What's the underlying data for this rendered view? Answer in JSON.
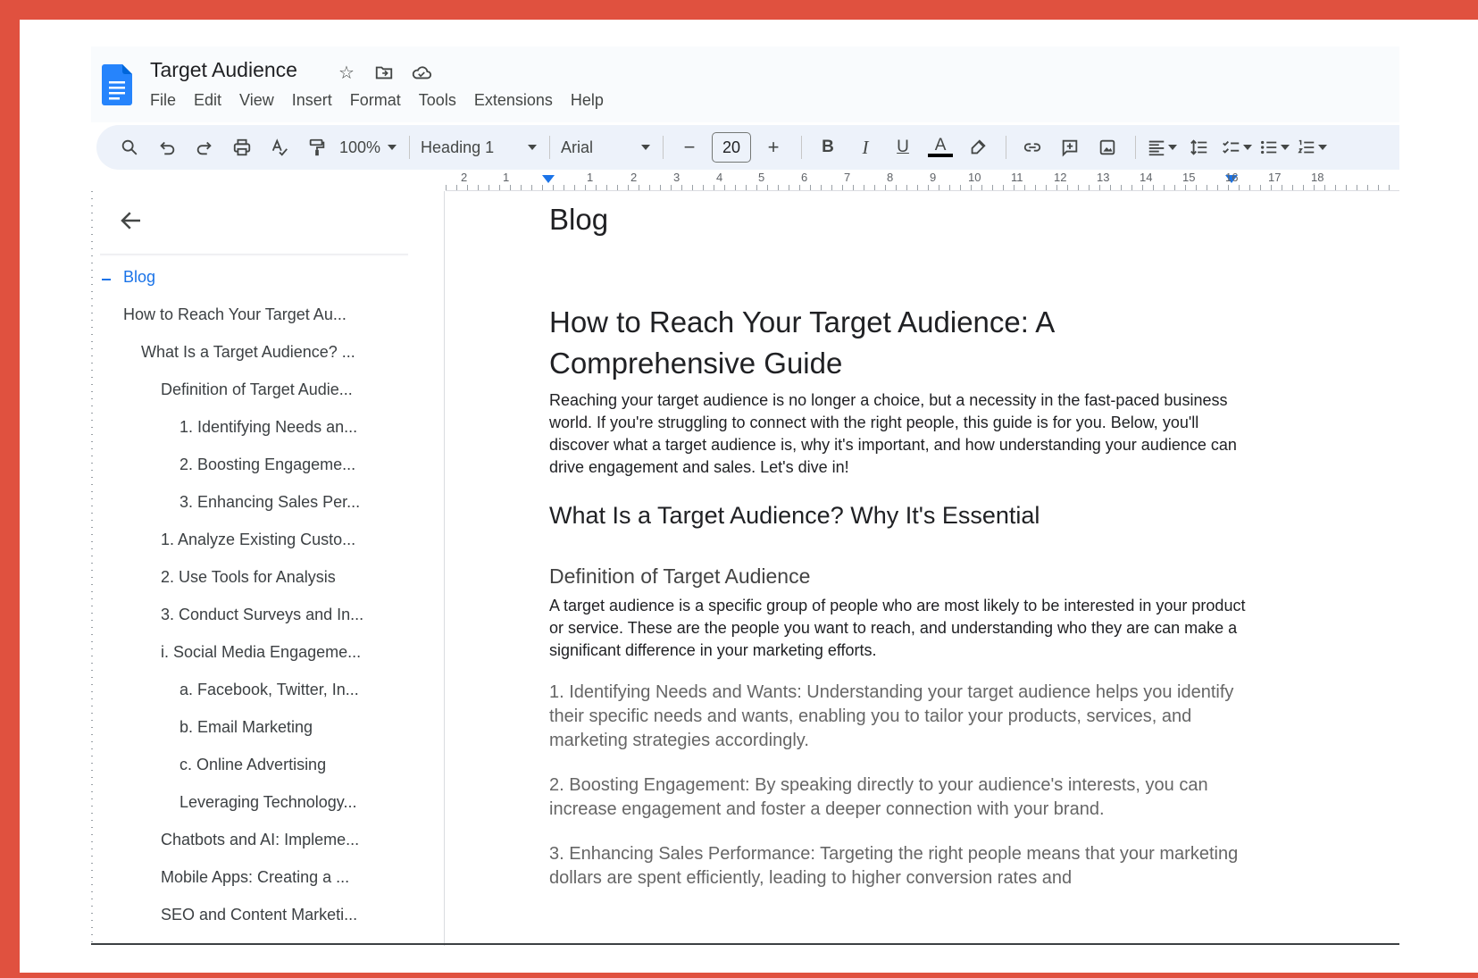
{
  "document": {
    "title": "Target Audience"
  },
  "menu": [
    "File",
    "Edit",
    "View",
    "Insert",
    "Format",
    "Tools",
    "Extensions",
    "Help"
  ],
  "toolbar": {
    "zoom": "100%",
    "style": "Heading 1",
    "font": "Arial",
    "font_size": "20",
    "minus": "−",
    "plus": "+",
    "bold": "B",
    "italic": "I",
    "underline": "U",
    "text_color": "A"
  },
  "ruler": {
    "numbers": [
      "2",
      "1",
      "1",
      "2",
      "3",
      "4",
      "5",
      "6",
      "7",
      "8",
      "9",
      "10",
      "11",
      "12",
      "13",
      "14",
      "15",
      "16",
      "17",
      "18"
    ]
  },
  "outline": {
    "items": [
      "Blog",
      "How to Reach Your Target Au...",
      "What Is a Target Audience? ...",
      "Definition of Target Audie...",
      "1. Identifying Needs an...",
      "2. Boosting Engageme...",
      "3. Enhancing Sales Per...",
      "1. Analyze Existing Custo...",
      "2. Use Tools for Analysis",
      "3. Conduct Surveys and In...",
      "i. Social Media Engageme...",
      "a. Facebook, Twitter, In...",
      "b. Email Marketing",
      "c. Online Advertising",
      "Leveraging Technology...",
      "Chatbots and AI: Impleme...",
      "Mobile Apps: Creating a ...",
      "SEO and Content Marketi..."
    ]
  },
  "body": {
    "title": "Blog",
    "h1": "How to Reach Your Target Audience: A Comprehensive Guide",
    "p1": "Reaching your target audience is no longer a choice, but a necessity in the fast-paced business world. If you're struggling to connect with the right people, this guide is for you. Below, you'll discover what a target audience is, why it's important, and how understanding your audience can drive engagement and sales. Let's dive in!",
    "h2": "What Is a Target Audience? Why It's Essential",
    "h3": "Definition of Target Audience",
    "p2": "A target audience is a specific group of people who are most likely to be interested in your product or service. These are the people you want to reach, and understanding who they are can make a significant difference in your marketing efforts.",
    "point1": "1. Identifying Needs and Wants: Understanding your target audience helps you identify their specific needs and wants, enabling you to tailor your products, services, and marketing strategies accordingly.",
    "point2": "2. Boosting Engagement: By speaking directly to your audience's interests, you can increase engagement and foster a deeper connection with your brand.",
    "point3": "3. Enhancing Sales Performance: Targeting the right people means that your marketing dollars are spent efficiently, leading to higher conversion rates and"
  },
  "colors": {
    "frame": "#e0513f",
    "accent": "#1a73e8",
    "toolbar_bg": "#edf2fa"
  }
}
